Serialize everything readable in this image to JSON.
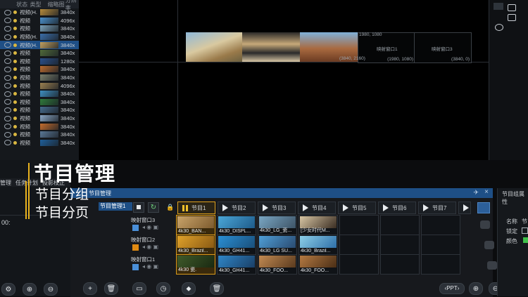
{
  "media_panel": {
    "headers": [
      "状态",
      "类型",
      "缩略图",
      "分辨率"
    ],
    "name_header": "名称",
    "rows": [
      {
        "type": "视频(H.",
        "res": "3840x",
        "selected": false,
        "color": "#b58a3a"
      },
      {
        "type": "视频",
        "res": "4096x",
        "selected": false,
        "color": "#4a8fc9"
      },
      {
        "type": "视频",
        "res": "3840x",
        "selected": false,
        "color": "#7aa0b8"
      },
      {
        "type": "视频(H.",
        "res": "3840x",
        "selected": false,
        "color": "#3b6ea8"
      },
      {
        "type": "视频(H.",
        "res": "3840x",
        "selected": true,
        "color": "#c2a060"
      },
      {
        "type": "视频",
        "res": "3840x",
        "selected": false,
        "color": "#506a3a"
      },
      {
        "type": "视频",
        "res": "1280x",
        "selected": false,
        "color": "#2a4f8a"
      },
      {
        "type": "视频",
        "res": "3840x",
        "selected": false,
        "color": "#b96a2e"
      },
      {
        "type": "视频",
        "res": "3840x",
        "selected": false,
        "color": "#7b7f6b"
      },
      {
        "type": "视频",
        "res": "4096x",
        "selected": false,
        "color": "#9a8050"
      },
      {
        "type": "视频",
        "res": "3840x",
        "selected": false,
        "color": "#3f8fbf"
      },
      {
        "type": "视频",
        "res": "3840x",
        "selected": false,
        "color": "#2f7a3a"
      },
      {
        "type": "视频",
        "res": "3840x",
        "selected": false,
        "color": "#466b8c"
      },
      {
        "type": "视频",
        "res": "3840x",
        "selected": false,
        "color": "#8aa6c4"
      },
      {
        "type": "视频",
        "res": "3840x",
        "selected": false,
        "color": "#c46d2d"
      },
      {
        "type": "视频",
        "res": "3840x",
        "selected": false,
        "color": "#5a7896"
      },
      {
        "type": "视频",
        "res": "3840x",
        "selected": false,
        "color": "#1f5f9a"
      }
    ]
  },
  "preview": {
    "screen_labels": [
      "映射窗口1",
      "映射窗口3"
    ],
    "coords": [
      "1980, 1080",
      "(3840, 2160)",
      "(1980, 1080)",
      "(3840, 0)"
    ]
  },
  "bottom_left": {
    "tabs": [
      "管理",
      "任务计划",
      "投影校正"
    ],
    "time": "00:"
  },
  "program": {
    "panel_title": "节目管理",
    "group_label": "节目管理1",
    "tabs": [
      "节目1",
      "节目2",
      "节目3",
      "节目4",
      "节目5",
      "节目6",
      "节目7"
    ],
    "rows": [
      {
        "label": "映射窗口3",
        "cells": [
          "4k30_BAN...",
          "4k30_DISPL...",
          "4k30_LG_瓷...",
          "[少女时代M..."
        ]
      },
      {
        "label": "映射窗口2",
        "cells": [
          "4k30_Brazil...",
          "4k30_GH41...",
          "4k30_LG SU...",
          "4k30_Brazil..."
        ]
      },
      {
        "label": "映射窗口1",
        "cells": [
          "4k30 瓷.",
          "4k30_GH41...",
          "4k30_FOO...",
          "4k30_FOO..."
        ]
      }
    ],
    "ppt_label": "‹PPT›"
  },
  "right_props": {
    "title": "节目组属性",
    "fields": [
      "名称",
      "锁定",
      "颜色"
    ],
    "name_value": "节"
  },
  "overlay": {
    "title": "节目管理",
    "line1": "节目分组",
    "line2": "节目分页"
  },
  "colors": {
    "accent": "#e8b21e",
    "selection": "#1f4f86",
    "titlebar": "#1e4f86"
  }
}
